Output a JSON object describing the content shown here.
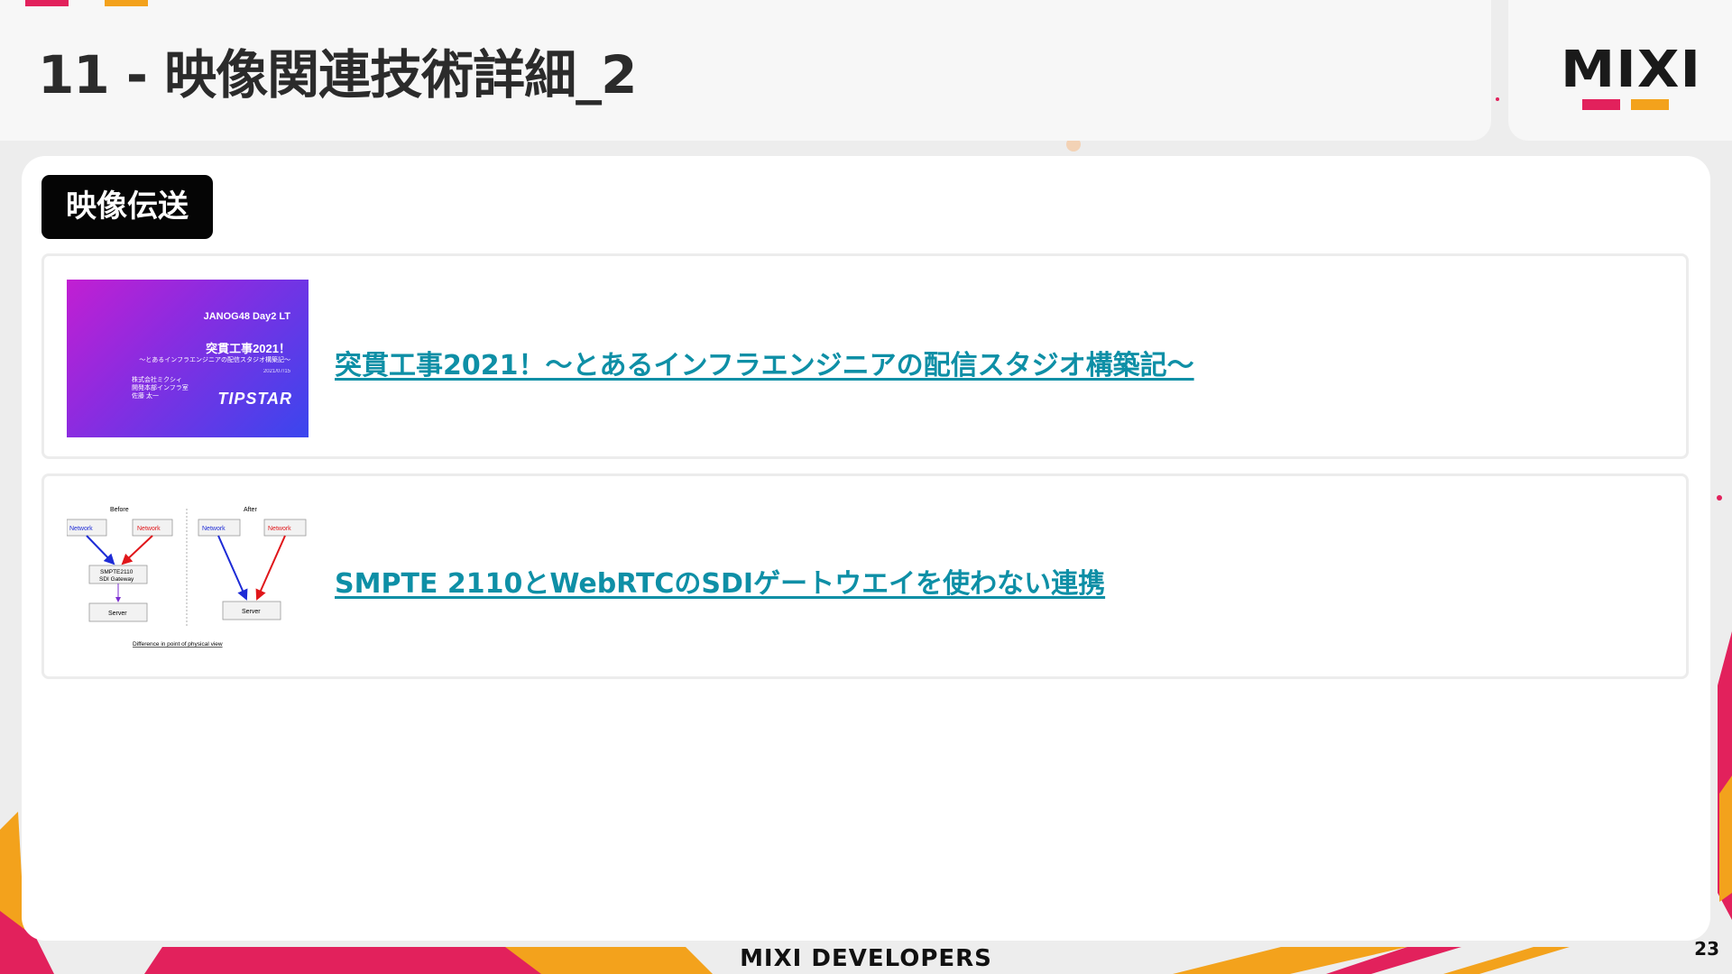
{
  "header": {
    "title": "11 - 映像関連技術詳細_2",
    "brand_logo": "MIXI",
    "colors": {
      "pink": "#e2215c",
      "orange": "#f3a21c"
    }
  },
  "section": {
    "tag": "映像伝送"
  },
  "links": [
    {
      "label": "突貫工事2021！〜とあるインフラエンジニアの配信スタジオ構築記〜",
      "thumbnail": {
        "event": "JANOG48 Day2 LT",
        "title": "突貫工事2021！",
        "subtitle": "〜とあるインフラエンジニアの配信スタジオ構築記〜",
        "date": "2021/07/15",
        "company": "株式会社ミクシィ",
        "department": "開発本部インフラ室",
        "speaker": "佐藤 太一",
        "brand": "TIPSTAR"
      }
    },
    {
      "label": "SMPTE 2110とWebRTCのSDIゲートウエイを使わない連携",
      "thumbnail": {
        "before_label": "Before",
        "after_label": "After",
        "network_label": "Network",
        "gateway_line1": "SMPTE2110",
        "gateway_line2": "SDI Gateway",
        "server_label": "Server",
        "caption": "Difference in point of physical view"
      }
    }
  ],
  "footer": {
    "brand": "MIXI DEVELOPERS",
    "page_number": "23"
  }
}
